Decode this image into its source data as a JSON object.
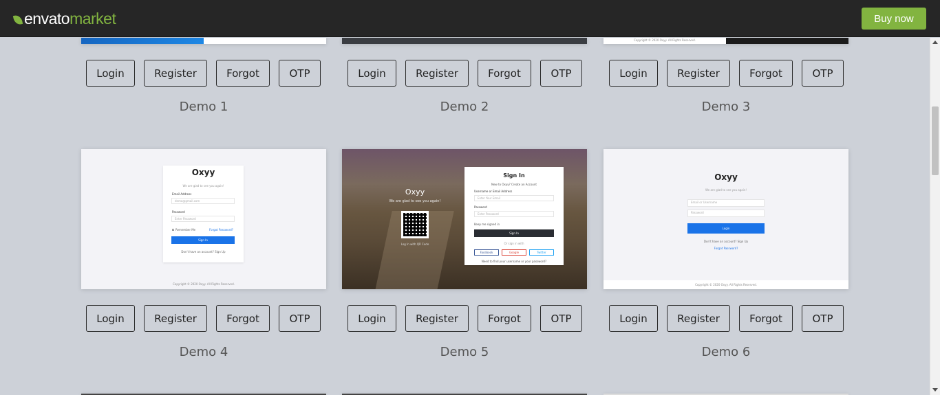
{
  "header": {
    "logo_envato": "envato",
    "logo_market": "market",
    "buy_label": "Buy now",
    "brand_color": "#82b440"
  },
  "buttons": {
    "login": "Login",
    "register": "Register",
    "forgot": "Forgot",
    "otp": "OTP"
  },
  "demos": [
    {
      "title": "Demo 1"
    },
    {
      "title": "Demo 2"
    },
    {
      "title": "Demo 3"
    },
    {
      "title": "Demo 4"
    },
    {
      "title": "Demo 5"
    },
    {
      "title": "Demo 6"
    }
  ],
  "previews": {
    "copyright_top": "Copyright © 2020 Oxyy. All Rights Reserved.",
    "demo4": {
      "brand": "Oxyy",
      "tagline": "We are glad to see you again!",
      "email_label": "Email Address",
      "email_value": "demo@gmail.com",
      "password_label": "Password",
      "password_placeholder": "Enter Password",
      "remember": "Remember Me",
      "forgot": "Forgot Password?",
      "signin": "Sign In",
      "signup": "Don't have an account? Sign Up",
      "copyright": "Copyright © 2020 Oxyy. All Rights Reserved."
    },
    "demo5": {
      "brand": "Oxyy",
      "tagline": "We are glad to see you again!",
      "qr_caption": "Log In with QR Code",
      "title": "Sign In",
      "new_to": "New to Oxyy? Create an Account",
      "user_label": "Username or Email Address",
      "user_placeholder": "Enter Your Email",
      "password_label": "Password",
      "password_placeholder": "Enter Password",
      "keep": "Keep me signed in",
      "signin": "Sign In",
      "or": "Or sign in with",
      "facebook": "Facebook",
      "google": "Google",
      "twitter": "Twitter",
      "need": "Need to find your username or your password?"
    },
    "demo6": {
      "brand": "Oxyy",
      "tagline": "We are glad to see you again!",
      "email_placeholder": "Email or Username",
      "password_placeholder": "Password",
      "login": "Login",
      "signup": "Don't have an account? Sign Up",
      "forgot": "Forgot Password?",
      "copyright": "Copyright © 2020 Oxyy. All Rights Reserved."
    }
  }
}
